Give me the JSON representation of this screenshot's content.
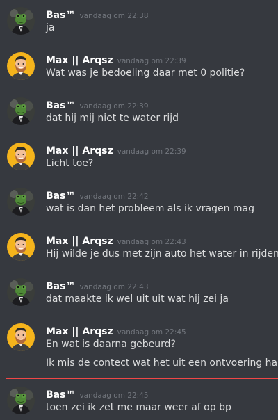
{
  "messages": [
    {
      "author": "Bas™",
      "timestamp": "vandaag om 22:38",
      "avatar": "frog-in-suit-avatar",
      "lines": [
        "ja"
      ]
    },
    {
      "author": "Max || Arqsz",
      "timestamp": "vandaag om 22:39",
      "avatar": "bearded-man-avatar",
      "lines": [
        "Wat was je bedoeling daar met 0 politie?"
      ]
    },
    {
      "author": "Bas™",
      "timestamp": "vandaag om 22:39",
      "avatar": "frog-in-suit-avatar",
      "lines": [
        "dat hij mij niet te water rijd"
      ]
    },
    {
      "author": "Max || Arqsz",
      "timestamp": "vandaag om 22:39",
      "avatar": "bearded-man-avatar",
      "lines": [
        "Licht toe?"
      ]
    },
    {
      "author": "Bas™",
      "timestamp": "vandaag om 22:42",
      "avatar": "frog-in-suit-avatar",
      "lines": [
        "wat is dan het probleem als ik vragen mag"
      ]
    },
    {
      "author": "Max || Arqsz",
      "timestamp": "vandaag om 22:43",
      "avatar": "bearded-man-avatar",
      "lines": [
        "Hij wilde je dus met zijn auto het water in rijden?"
      ]
    },
    {
      "author": "Bas™",
      "timestamp": "vandaag om 22:43",
      "avatar": "frog-in-suit-avatar",
      "lines": [
        "dat maakte ik wel uit uit wat hij zei ja"
      ]
    },
    {
      "author": "Max || Arqsz",
      "timestamp": "vandaag om 22:45",
      "avatar": "bearded-man-avatar",
      "lines": [
        "En wat is daarna gebeurd?",
        "Ik mis de contect wat het uit een ontvoering haalt"
      ]
    },
    {
      "author": "Bas™",
      "timestamp": "vandaag om 22:45",
      "avatar": "frog-in-suit-avatar",
      "lines": [
        "toen zei ik zet me maar weer af op bp"
      ]
    }
  ],
  "colors": {
    "background": "#36393f",
    "author": "#ffffff",
    "timestamp": "#72767d",
    "text": "#dcddde",
    "new_messages_divider": "#f04747"
  }
}
